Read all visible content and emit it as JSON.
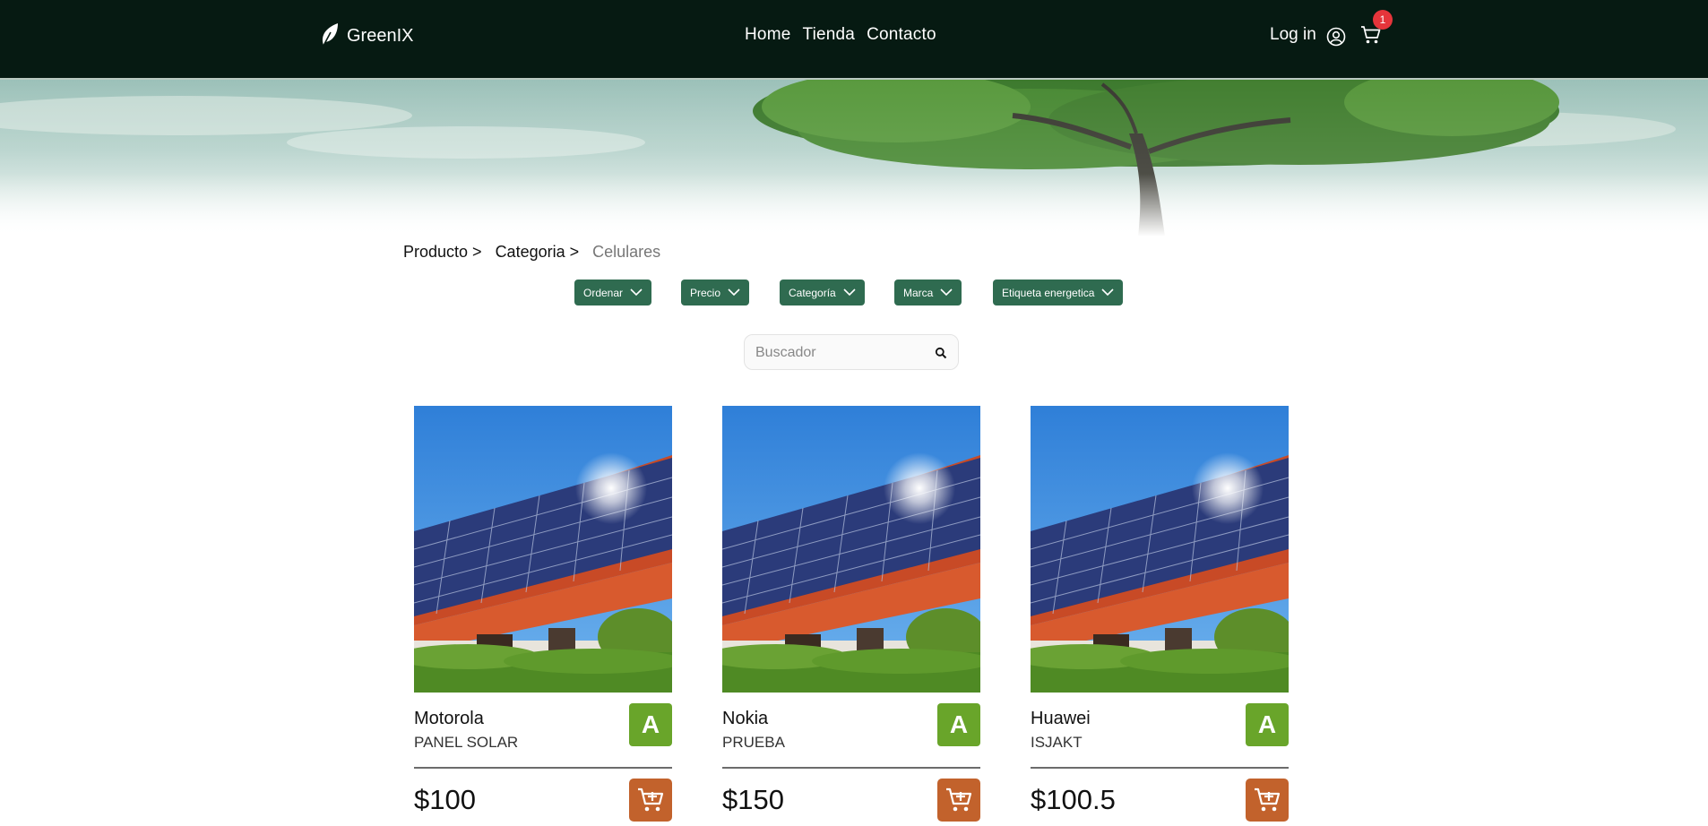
{
  "header": {
    "brand": "GreenIX",
    "nav": [
      "Home",
      "Tienda",
      "Contacto"
    ],
    "login": "Log in",
    "cart_count": "1"
  },
  "breadcrumb": [
    "Producto >",
    "Categoria >",
    "Celulares"
  ],
  "filters": [
    "Ordenar",
    "Precio",
    "Categoría",
    "Marca",
    "Etiqueta energetica"
  ],
  "search": {
    "placeholder": "Buscador"
  },
  "products": [
    {
      "brand": "Motorola",
      "model": "PANEL SOLAR",
      "energy_label": "A",
      "price": "$100"
    },
    {
      "brand": "Nokia",
      "model": "PRUEBA",
      "energy_label": "A",
      "price": "$150"
    },
    {
      "brand": "Huawei",
      "model": "ISJAKT",
      "energy_label": "A",
      "price": "$100.5"
    }
  ],
  "colors": {
    "header_bg": "#061a12",
    "filter_bg": "#2f6b50",
    "energy_label_bg": "#69a52a",
    "cart_button_bg": "#c2622c",
    "badge_bg": "#e5353b"
  }
}
